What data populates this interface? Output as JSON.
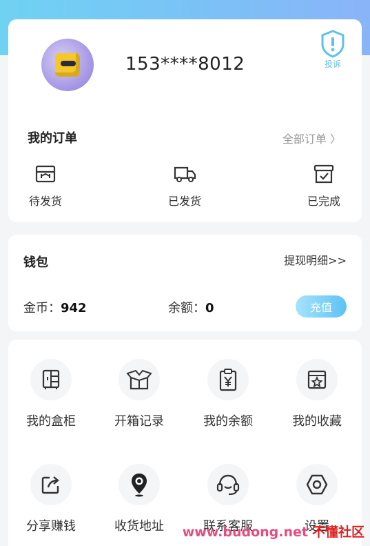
{
  "profile": {
    "phone": "153****8012",
    "complain_label": "投诉"
  },
  "orders": {
    "title": "我的订单",
    "all_label": "全部订单 〉",
    "items": [
      {
        "label": "待发货",
        "icon": "pending-shipment-icon"
      },
      {
        "label": "已发货",
        "icon": "truck-icon"
      },
      {
        "label": "已完成",
        "icon": "completed-box-icon"
      }
    ]
  },
  "wallet": {
    "title": "钱包",
    "detail_label": "提现明细>>",
    "coins_label": "金币：",
    "coins_value": "942",
    "balance_label": "余额：",
    "balance_value": "0",
    "recharge_label": "充值"
  },
  "grid": {
    "items": [
      {
        "label": "我的盒柜",
        "icon": "cabinet-icon"
      },
      {
        "label": "开箱记录",
        "icon": "open-box-icon"
      },
      {
        "label": "我的余额",
        "icon": "yuan-clipboard-icon"
      },
      {
        "label": "我的收藏",
        "icon": "star-box-icon"
      },
      {
        "label": "分享赚钱",
        "icon": "share-icon"
      },
      {
        "label": "收货地址",
        "icon": "location-pin-icon"
      },
      {
        "label": "联系客服",
        "icon": "headset-icon"
      },
      {
        "label": "设置",
        "icon": "settings-hex-icon"
      }
    ]
  },
  "watermark": {
    "url": "www.budong.net",
    "name": "不懂社区"
  },
  "colors": {
    "accent": "#5cc3f4",
    "band_start": "#6fd2f3",
    "watermark_pink": "#e64d7e",
    "watermark_red": "#e02020"
  }
}
